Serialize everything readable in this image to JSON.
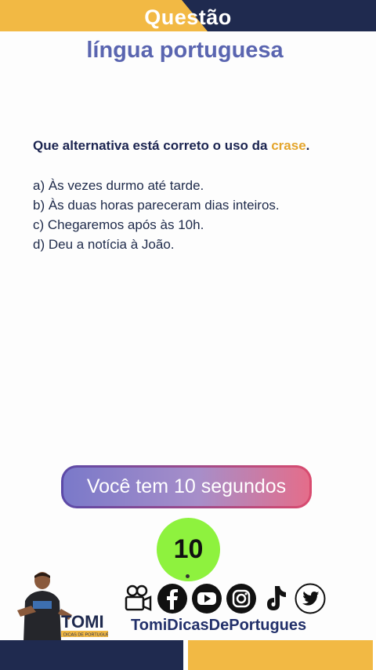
{
  "header": {
    "title": "Questão",
    "subject": "língua portuguesa"
  },
  "question": {
    "prefix": "Que alternativa está correto o uso da ",
    "highlight": "crase",
    "suffix": "."
  },
  "options": [
    "a) Às vezes durmo até tarde.",
    "b) Às duas horas pareceram dias inteiros.",
    "c) Chegaremos após às 10h.",
    "d) Deu a notícia à João."
  ],
  "timer": {
    "message": "Você tem 10 segundos",
    "countdown": "10"
  },
  "brand": {
    "logo_text": "TOMI",
    "logo_tagline": "DICAS DE PORTUGUÊS",
    "handle": "TomiDicasDePortugues"
  },
  "social_icons": [
    "video-camera-icon",
    "facebook-icon",
    "youtube-icon",
    "instagram-icon",
    "tiktok-icon",
    "twitter-icon"
  ],
  "colors": {
    "navy": "#1f2a4f",
    "gold": "#f2b944",
    "accent": "#e4a52c",
    "subject": "#5a65b0",
    "timer_green": "#8ef23e"
  }
}
